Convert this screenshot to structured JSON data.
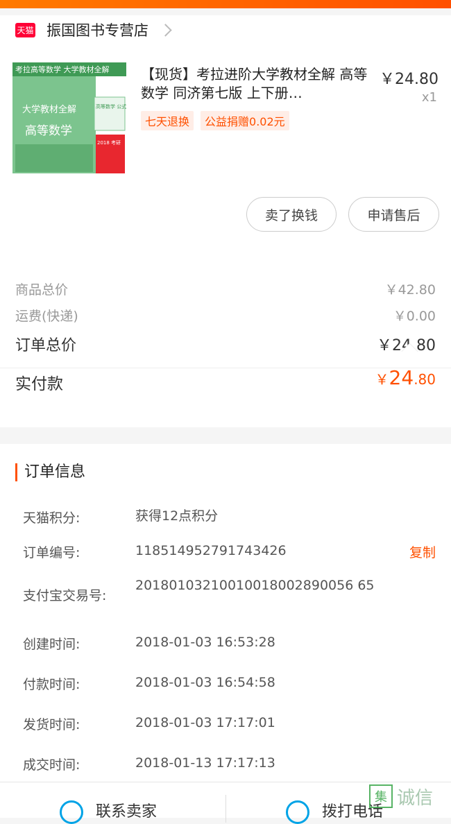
{
  "store": {
    "logo_text": "天猫",
    "name": "振国图书专营店"
  },
  "product": {
    "title": "【现货】考拉进阶大学教材全解 高等数学 同济第七版 上下册…",
    "price": "￥24.80",
    "quantity": "x1",
    "tags": [
      "七天退换",
      "公益捐赠0.02元"
    ],
    "cover_header": "考拉高等数学  大学教材全解",
    "cover_title": "大学教材全解",
    "cover_subtitle": "高等数学",
    "cover_badge1": "高等数学 公式表",
    "cover_badge2": "2018 考研"
  },
  "actions": {
    "sell": "卖了换钱",
    "after_sale": "申请售后"
  },
  "summary": {
    "goods_total_label": "商品总价",
    "goods_total": "￥42.80",
    "shipping_label": "运费(快递)",
    "shipping": "￥0.00",
    "order_total_label": "订单总价",
    "order_total": "￥24.80",
    "paid_label": "实付款",
    "paid_currency": "￥",
    "paid_int": "24",
    "paid_dec": ".80"
  },
  "order_info": {
    "title": "订单信息",
    "copy_label": "复制",
    "rows": [
      {
        "k": "天猫积分:",
        "v": "获得12点积分"
      },
      {
        "k": "订单编号:",
        "v": "118514952791743426"
      },
      {
        "k": "支付宝交易号:",
        "v": "20180103210010018002890056 65"
      },
      {
        "k": "创建时间:",
        "v": "2018-01-03 16:53:28"
      },
      {
        "k": "付款时间:",
        "v": "2018-01-03 16:54:58"
      },
      {
        "k": "发货时间:",
        "v": "2018-01-03 17:17:01"
      },
      {
        "k": "成交时间:",
        "v": "2018-01-13 17:17:13"
      }
    ]
  },
  "footer": {
    "contact": "联系卖家",
    "call": "拨打电话"
  },
  "watermark": {
    "mark": "集",
    "text": "诚信"
  },
  "colors": {
    "accent": "#ff5000",
    "tmall_red": "#ff0036",
    "icon_blue": "#00a3e6"
  }
}
